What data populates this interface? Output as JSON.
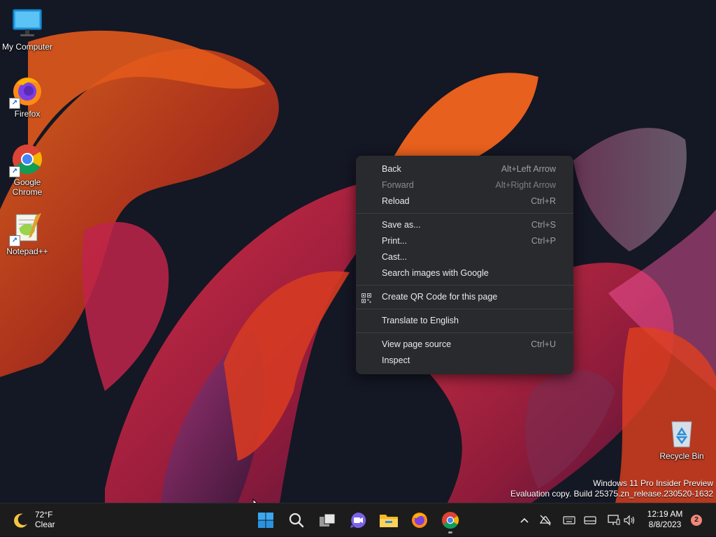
{
  "desktop": {
    "icons": [
      {
        "label_line1": "My Computer",
        "label_line2": "",
        "icon": "monitor-icon"
      },
      {
        "label_line1": "Firefox",
        "label_line2": "",
        "icon": "firefox-icon"
      },
      {
        "label_line1": "Google",
        "label_line2": "Chrome",
        "icon": "chrome-icon"
      },
      {
        "label_line1": "Notepad++",
        "label_line2": "",
        "icon": "notepad-plus-plus-icon"
      },
      {
        "label_line1": "Recycle Bin",
        "label_line2": "",
        "icon": "recycle-bin-icon"
      }
    ]
  },
  "context_menu": {
    "groups": [
      [
        {
          "label": "Back",
          "shortcut": "Alt+Left Arrow",
          "enabled": true
        },
        {
          "label": "Forward",
          "shortcut": "Alt+Right Arrow",
          "enabled": false
        },
        {
          "label": "Reload",
          "shortcut": "Ctrl+R",
          "enabled": true
        }
      ],
      [
        {
          "label": "Save as...",
          "shortcut": "Ctrl+S",
          "enabled": true
        },
        {
          "label": "Print...",
          "shortcut": "Ctrl+P",
          "enabled": true
        },
        {
          "label": "Cast...",
          "shortcut": "",
          "enabled": true
        },
        {
          "label": "Search images with Google",
          "shortcut": "",
          "enabled": true
        }
      ],
      [
        {
          "label": "Create QR Code for this page",
          "shortcut": "",
          "enabled": true,
          "icon": "qr-code-icon"
        }
      ],
      [
        {
          "label": "Translate to English",
          "shortcut": "",
          "enabled": true
        }
      ],
      [
        {
          "label": "View page source",
          "shortcut": "Ctrl+U",
          "enabled": true
        },
        {
          "label": "Inspect",
          "shortcut": "",
          "enabled": true
        }
      ]
    ]
  },
  "watermark": {
    "line1": "Windows 11 Pro Insider Preview",
    "line2": "Evaluation copy. Build 25375.zn_release.230520-1632"
  },
  "taskbar": {
    "weather": {
      "temp": "72°F",
      "condition": "Clear",
      "icon": "moon-icon"
    },
    "apps": [
      "start-icon",
      "search-icon",
      "task-view-icon",
      "chat-icon",
      "file-explorer-icon",
      "firefox-icon",
      "chrome-icon"
    ],
    "tray_icons": [
      "chevron-up-icon",
      "network-off-icon",
      "keyboard-icon",
      "touch-keyboard-icon",
      "display-icon",
      "volume-icon"
    ],
    "clock": {
      "time": "12:19 AM",
      "date": "8/8/2023"
    },
    "notification_count": "2"
  },
  "colors": {
    "menu_bg": "#292a2d",
    "taskbar_bg": "#1c1c1c",
    "notification_badge": "#f2867a"
  }
}
